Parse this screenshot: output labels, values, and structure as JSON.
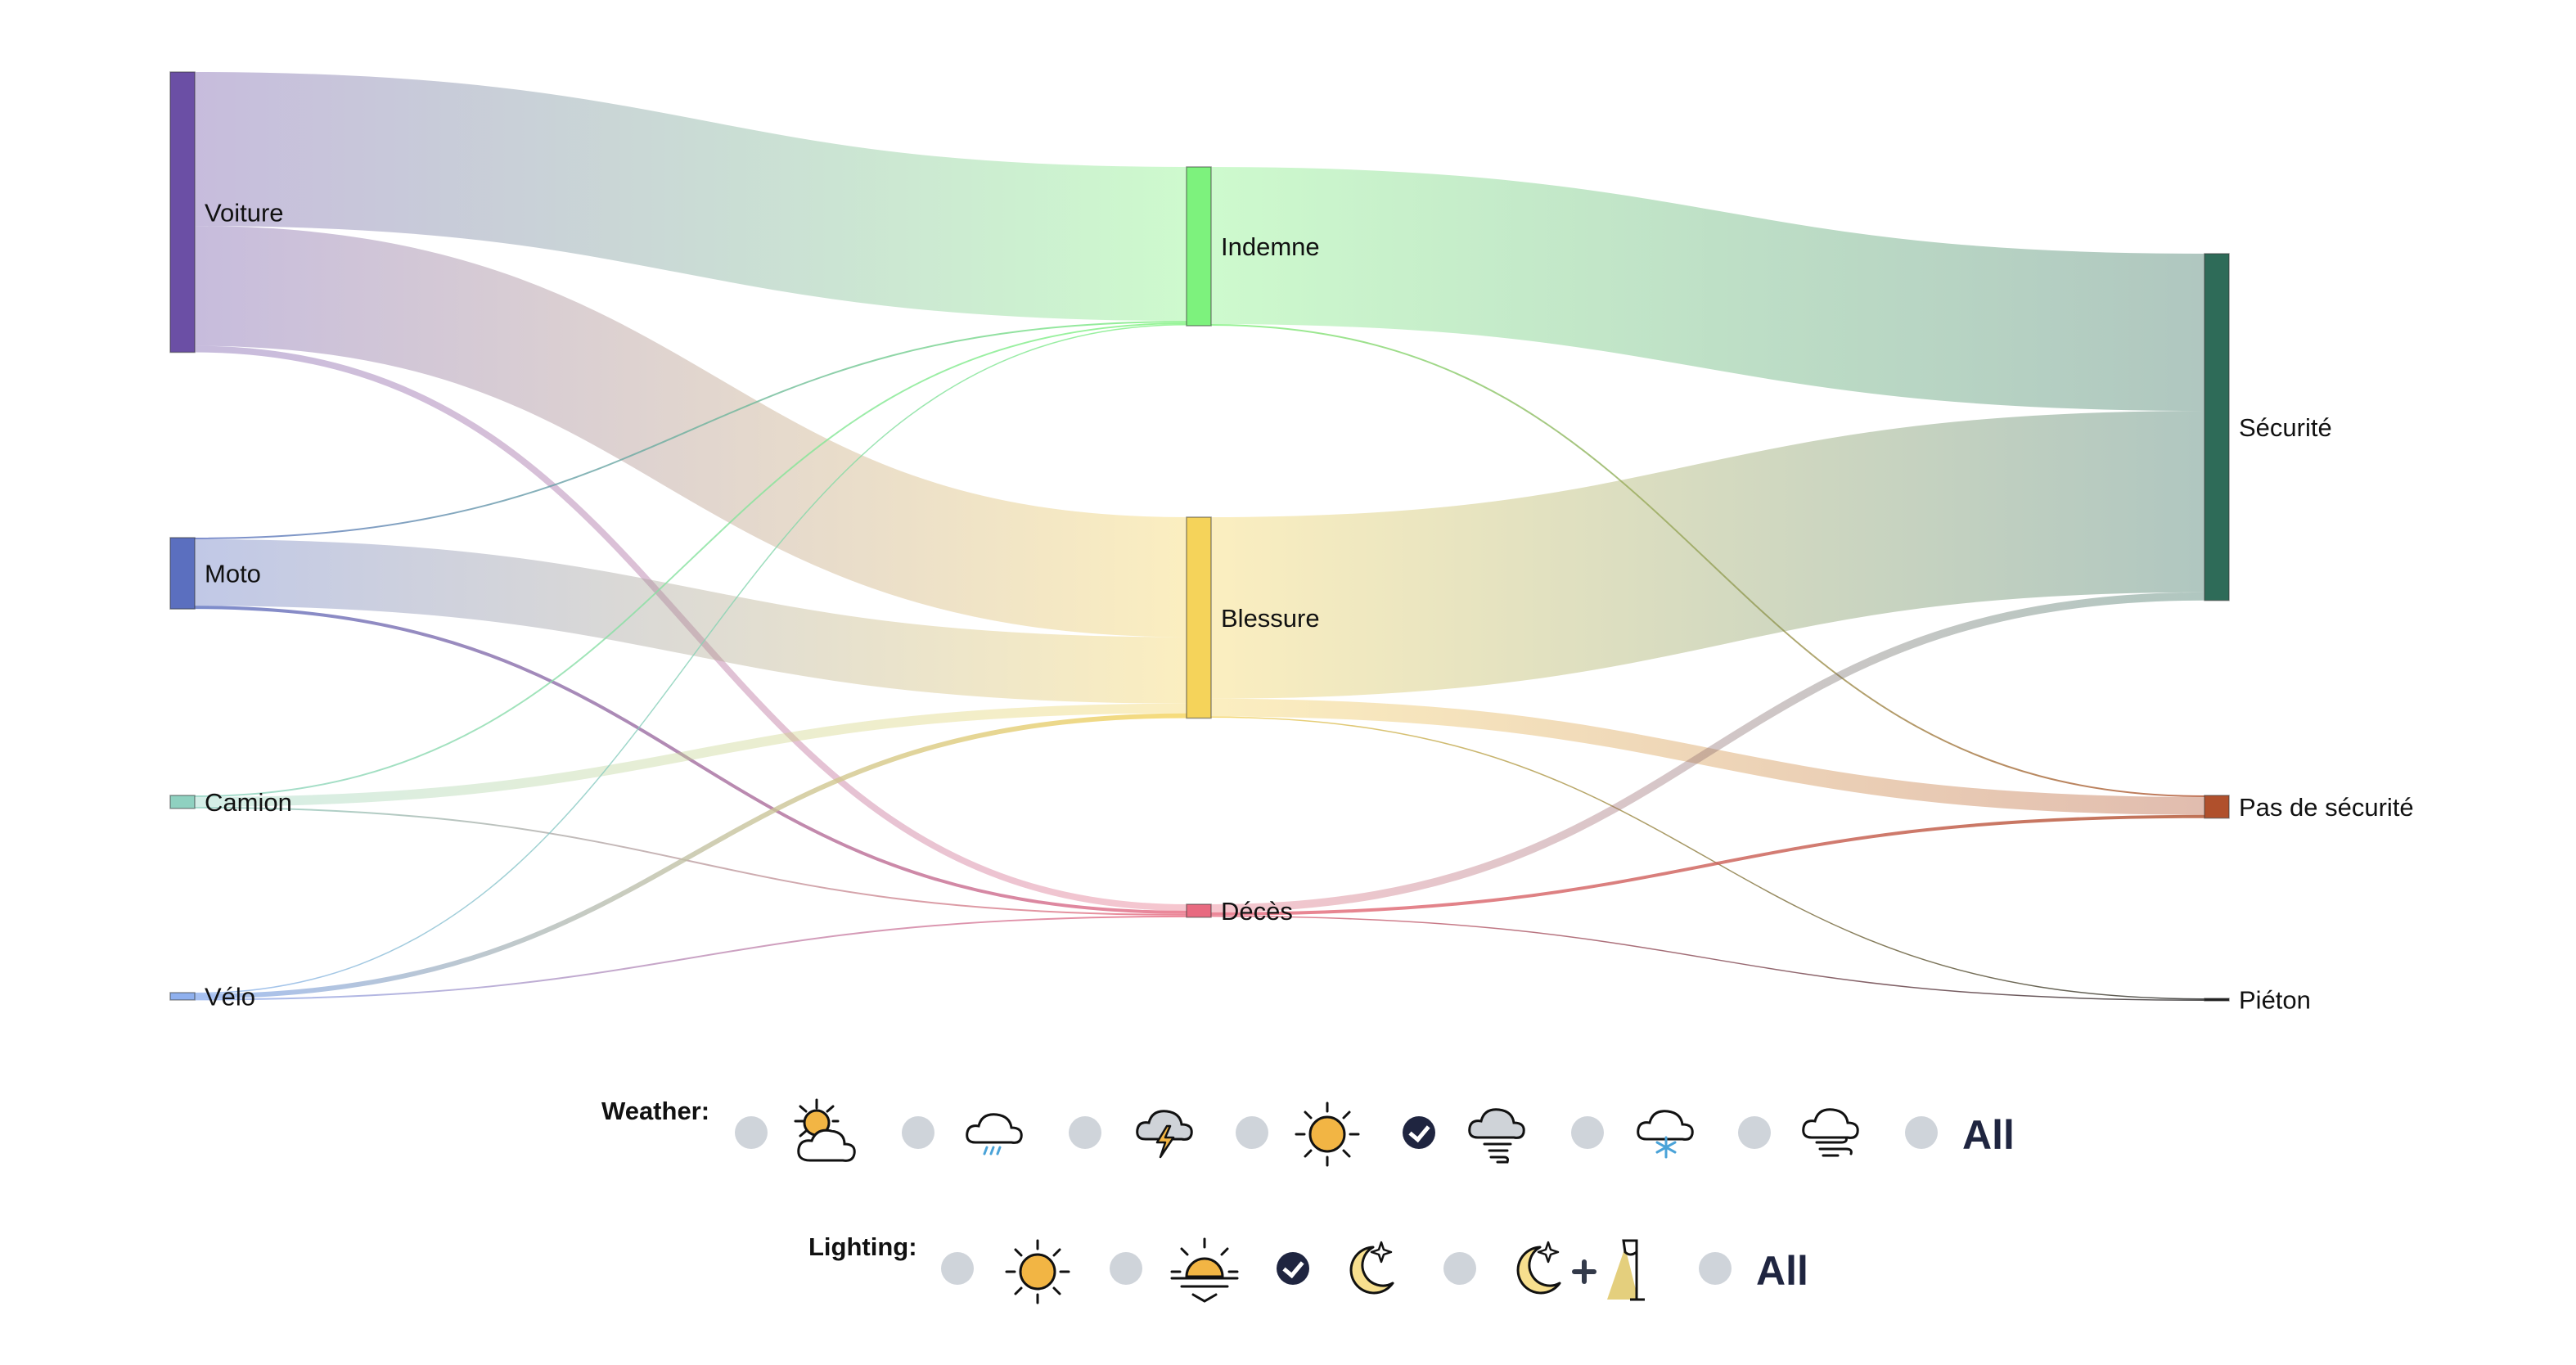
{
  "chart_data": {
    "type": "sankey",
    "nodes": [
      {
        "id": "voiture",
        "label": "Voiture",
        "column": 0,
        "color": "#6b4fa5"
      },
      {
        "id": "moto",
        "label": "Moto",
        "column": 0,
        "color": "#5b6fbf"
      },
      {
        "id": "camion",
        "label": "Camion",
        "column": 0,
        "color": "#8fd1c0"
      },
      {
        "id": "velo",
        "label": "Vélo",
        "column": 0,
        "color": "#8fb0ee"
      },
      {
        "id": "indemne",
        "label": "Indemne",
        "column": 1,
        "color": "#7df27d"
      },
      {
        "id": "blessure",
        "label": "Blessure",
        "column": 1,
        "color": "#f5d35a"
      },
      {
        "id": "deces",
        "label": "Décès",
        "column": 1,
        "color": "#e86a80"
      },
      {
        "id": "securite",
        "label": "Sécurité",
        "column": 2,
        "color": "#2e6b58"
      },
      {
        "id": "pas_securite",
        "label": "Pas de sécurité",
        "column": 2,
        "color": "#b0502c"
      },
      {
        "id": "pieton",
        "label": "Piéton",
        "column": 2,
        "color": "#222222"
      }
    ],
    "links": [
      {
        "source": "voiture",
        "target": "indemne",
        "value": 95
      },
      {
        "source": "voiture",
        "target": "blessure",
        "value": 74
      },
      {
        "source": "voiture",
        "target": "deces",
        "value": 4
      },
      {
        "source": "moto",
        "target": "indemne",
        "value": 1
      },
      {
        "source": "moto",
        "target": "blessure",
        "value": 41
      },
      {
        "source": "moto",
        "target": "deces",
        "value": 2
      },
      {
        "source": "camion",
        "target": "indemne",
        "value": 1
      },
      {
        "source": "camion",
        "target": "blessure",
        "value": 6
      },
      {
        "source": "camion",
        "target": "deces",
        "value": 1
      },
      {
        "source": "velo",
        "target": "indemne",
        "value": 0.5
      },
      {
        "source": "velo",
        "target": "blessure",
        "value": 3
      },
      {
        "source": "velo",
        "target": "deces",
        "value": 1
      },
      {
        "source": "indemne",
        "target": "securite",
        "value": 97
      },
      {
        "source": "indemne",
        "target": "pas_securite",
        "value": 1
      },
      {
        "source": "blessure",
        "target": "securite",
        "value": 112
      },
      {
        "source": "blessure",
        "target": "pas_securite",
        "value": 11
      },
      {
        "source": "blessure",
        "target": "pieton",
        "value": 0.5
      },
      {
        "source": "deces",
        "target": "securite",
        "value": 5
      },
      {
        "source": "deces",
        "target": "pas_securite",
        "value": 2
      },
      {
        "source": "deces",
        "target": "pieton",
        "value": 0.5
      }
    ]
  },
  "weather": {
    "title": "Weather:",
    "options": [
      {
        "icon": "partly-cloudy-sun-icon",
        "checked": false
      },
      {
        "icon": "rain-cloud-icon",
        "checked": false
      },
      {
        "icon": "thunderstorm-icon",
        "checked": false
      },
      {
        "icon": "sun-icon",
        "checked": false
      },
      {
        "icon": "fog-icon",
        "checked": true
      },
      {
        "icon": "snow-cloud-icon",
        "checked": false
      },
      {
        "icon": "wind-cloud-icon",
        "checked": false
      },
      {
        "icon": "all",
        "label": "All",
        "checked": false
      }
    ]
  },
  "lighting": {
    "title": "Lighting:",
    "options": [
      {
        "icon": "day-sun-icon",
        "checked": false
      },
      {
        "icon": "sunset-icon",
        "checked": false
      },
      {
        "icon": "night-moon-icon",
        "checked": true
      },
      {
        "icon": "night-streetlight-icon",
        "checked": false
      },
      {
        "icon": "all",
        "label": "All",
        "checked": false
      }
    ]
  }
}
